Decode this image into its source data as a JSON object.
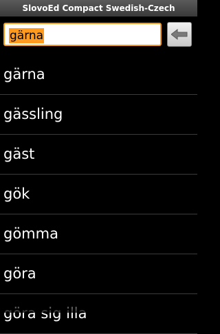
{
  "app": {
    "title": "SlovoEd Compact Swedish-Czech"
  },
  "search": {
    "value": "gärna",
    "clear_icon": "backspace-arrow-icon"
  },
  "words": [
    "gärna",
    "gässling",
    "gäst",
    "gök",
    "gömma",
    "göra",
    "göra sig illa"
  ],
  "colors": {
    "background": "#000000",
    "highlight": "#ff9a1f",
    "field_border": "#f39c1f",
    "text": "#ffffff"
  }
}
